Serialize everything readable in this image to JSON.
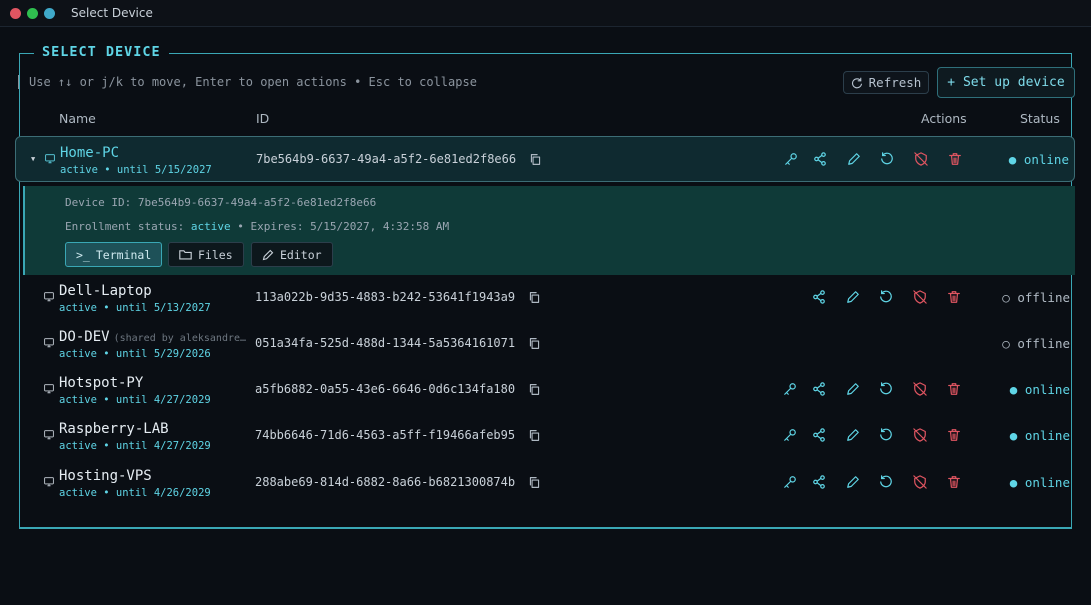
{
  "window": {
    "title": "Select Device",
    "controls": [
      {
        "color": "#e05561"
      },
      {
        "color": "#2fbf4f"
      },
      {
        "color": "#3fa9c9"
      }
    ]
  },
  "panel": {
    "title": "SELECT DEVICE",
    "hint": "Use ↑↓ or j/k to move, Enter to open actions • Esc to collapse",
    "refresh_label": "Refresh",
    "setup_label": "+ Set up device"
  },
  "columns": {
    "name": "Name",
    "id": "ID",
    "actions": "Actions",
    "status": "Status"
  },
  "devices": [
    {
      "name": "Home-PC",
      "shared": "",
      "sub": "active • until 5/15/2027",
      "id": "7be564b9-6637-49a4-a5f2-6e81ed2f8e66",
      "status": "● online",
      "online": true,
      "key": true,
      "actions": true,
      "expanded": true
    },
    {
      "name": "Dell-Laptop",
      "shared": "",
      "sub": "active • until 5/13/2027",
      "id": "113a022b-9d35-4883-b242-53641f1943a9",
      "status": "○ offline",
      "online": false,
      "key": false,
      "actions": true
    },
    {
      "name": "DO-DEV",
      "shared": "(shared by aleksandre…",
      "sub": "active • until 5/29/2026",
      "id": "051a34fa-525d-488d-1344-5a5364161071",
      "status": "○ offline",
      "online": false,
      "key": false,
      "actions": false
    },
    {
      "name": "Hotspot-PY",
      "shared": "",
      "sub": "active • until 4/27/2029",
      "id": "a5fb6882-0a55-43e6-6646-0d6c134fa180",
      "status": "● online",
      "online": true,
      "key": true,
      "actions": true
    },
    {
      "name": "Raspberry-LAB",
      "shared": "",
      "sub": "active • until 4/27/2029",
      "id": "74bb6646-71d6-4563-a5ff-f19466afeb95",
      "status": "● online",
      "online": true,
      "key": true,
      "actions": true
    },
    {
      "name": "Hosting-VPS",
      "shared": "",
      "sub": "active • until 4/26/2029",
      "id": "288abe69-814d-6882-8a66-b6821300874b",
      "status": "● online",
      "online": true,
      "key": true,
      "actions": true
    }
  ],
  "details": {
    "device_id_label": "Device ID:",
    "device_id": "7be564b9-6637-49a4-a5f2-6e81ed2f8e66",
    "enroll_label": "Enrollment status:",
    "enroll_status": "active",
    "expires": "• Expires: 5/15/2027, 4:32:58 AM",
    "terminal_label": "Terminal",
    "files_label": "Files",
    "editor_label": "Editor"
  },
  "icons": {
    "copy": "copy-icon",
    "key": "key-icon",
    "share": "share-icon",
    "edit": "pencil-icon",
    "reset": "refresh-icon",
    "revoke": "shield-off-icon",
    "delete": "trash-icon",
    "device": "monitor-icon"
  },
  "colors": {
    "accent": "#5fd5e6",
    "danger": "#e05561",
    "background": "#0a0e14"
  }
}
